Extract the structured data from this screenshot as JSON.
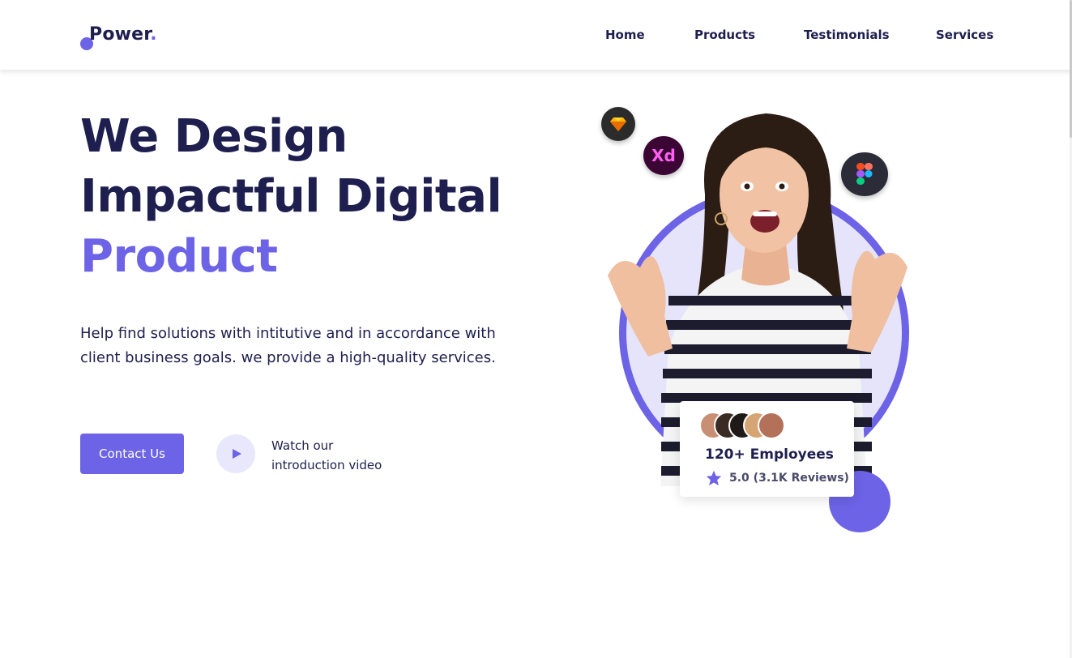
{
  "brand": {
    "name": "Power",
    "suffix": "."
  },
  "nav": {
    "items": [
      {
        "label": "Home"
      },
      {
        "label": "Products"
      },
      {
        "label": "Testimonials"
      },
      {
        "label": "Services"
      }
    ]
  },
  "hero": {
    "headline_line1": "We Design",
    "headline_line2": "Impactful Digital",
    "headline_line3": "Product",
    "description": "Help find solutions with intitutive and in accordance with client business goals. we provide a high-quality services.",
    "contact_label": "Contact Us",
    "video_line1": "Watch our",
    "video_line2": "introduction video"
  },
  "card": {
    "employees": "120+ Employees",
    "rating": "5.0 (3.1K Reviews)"
  },
  "apps": {
    "xd_label": "Xd"
  },
  "colors": {
    "accent": "#6c63e6",
    "dark": "#1e1e4f",
    "light_accent": "#e9e7fb"
  },
  "icons": [
    "logo-mark-icon",
    "sketch-icon",
    "xd-icon",
    "figma-icon",
    "play-icon",
    "star-icon"
  ]
}
